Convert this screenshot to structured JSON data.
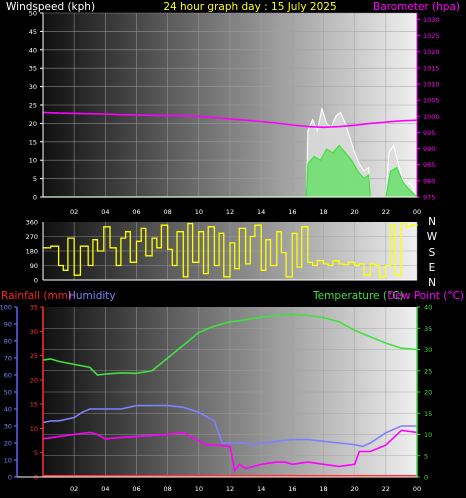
{
  "header": {
    "left": "Windspeed (kph)",
    "center": "24 hour graph day : 15 July 2025",
    "right": "Barometer (hpa)"
  },
  "compass": [
    "N",
    "W",
    "S",
    "E",
    "N"
  ],
  "bottom_header": {
    "rain": "Rainfall (mm)",
    "humidity": "Humidity",
    "temperature": "Temperature (°C)",
    "dewpoint": "Dew Point (°C)"
  },
  "colors": {
    "windspeed_label": "#ffffff",
    "title": "#ffff00",
    "barometer": "#ff00ff",
    "wind_line": "#ffffff",
    "gust_fill": "#70e070",
    "direction": "#ffff00",
    "rain": "#ff3030",
    "humidity": "#8080ff",
    "temperature": "#40e040",
    "dewpoint": "#ff00ff",
    "axis_tick_white": "#ffffff",
    "right_axis_green": "#40e040"
  },
  "chart_data": [
    {
      "id": "wind_baro",
      "type": "line",
      "title": "24 hour graph day : 15 July 2025",
      "x_ticks": [
        "02",
        "04",
        "06",
        "08",
        "10",
        "12",
        "14",
        "16",
        "18",
        "20",
        "22",
        "00"
      ],
      "left_axis": {
        "label": "Windspeed (kph)",
        "ticks": [
          0,
          5,
          10,
          15,
          20,
          25,
          30,
          35,
          40,
          45,
          50
        ],
        "range": [
          0,
          50
        ]
      },
      "right_axis": {
        "label": "Barometer (hpa)",
        "ticks": [
          975,
          980,
          985,
          990,
          995,
          1000,
          1005,
          1010,
          1015,
          1020,
          1025,
          1030
        ],
        "range": [
          975,
          1032
        ]
      },
      "series": [
        {
          "name": "Barometer (hpa)",
          "axis": "right",
          "hours": [
            0,
            1,
            2,
            3,
            4,
            5,
            6,
            7,
            8,
            9,
            10,
            11,
            12,
            13,
            14,
            15,
            16,
            17,
            18,
            19,
            20,
            21,
            22,
            23,
            24
          ],
          "values": [
            1001.2,
            1001.0,
            1000.9,
            1000.8,
            1000.7,
            1000.5,
            1000.4,
            1000.3,
            1000.2,
            1000.2,
            1000.0,
            999.6,
            999.2,
            998.8,
            998.4,
            997.9,
            997.3,
            996.8,
            996.6,
            996.8,
            997.2,
            997.8,
            998.2,
            998.6,
            998.8
          ]
        },
        {
          "name": "Wind gust (kph)",
          "axis": "left",
          "hours": [
            0,
            16.9,
            17.0,
            17.3,
            17.6,
            17.9,
            18.2,
            18.5,
            18.8,
            19.1,
            19.4,
            19.7,
            20.0,
            20.3,
            20.6,
            20.9,
            21.0,
            21.6,
            22.0,
            22.2,
            22.5,
            22.8,
            23.0,
            23.2,
            23.5,
            24
          ],
          "values": [
            0,
            0,
            18,
            21,
            18,
            24,
            20,
            19,
            22,
            23,
            20,
            16,
            12,
            9,
            7,
            8,
            0,
            0,
            0,
            12,
            14,
            9,
            6,
            2,
            4,
            0
          ]
        },
        {
          "name": "Wind speed (kph)",
          "axis": "left",
          "hours": [
            0,
            16.9,
            17.0,
            17.4,
            17.8,
            18.2,
            18.6,
            19.0,
            19.4,
            19.8,
            20.2,
            20.6,
            20.9,
            21.0,
            22.0,
            22.3,
            22.7,
            23.1,
            23.5,
            24
          ],
          "values": [
            0,
            0,
            9,
            11,
            10,
            13,
            12,
            14,
            12,
            10,
            7,
            5,
            6,
            0,
            0,
            7,
            8,
            4,
            2,
            0
          ]
        }
      ]
    },
    {
      "id": "direction",
      "type": "line",
      "x_ticks": [
        "02",
        "04",
        "06",
        "08",
        "10",
        "12",
        "14",
        "16",
        "18",
        "20",
        "22",
        "00"
      ],
      "left_axis": {
        "ticks": [
          0,
          90,
          180,
          270,
          360
        ],
        "range": [
          0,
          360
        ]
      },
      "series": [
        {
          "name": "Wind direction (°)",
          "hours": [
            0,
            0.5,
            1.0,
            1.3,
            1.6,
            2.0,
            2.4,
            2.9,
            3.2,
            3.5,
            3.9,
            4.3,
            4.7,
            5.0,
            5.3,
            5.6,
            6.0,
            6.3,
            6.6,
            7.0,
            7.3,
            7.6,
            8.0,
            8.3,
            8.6,
            9.0,
            9.3,
            9.6,
            10.0,
            10.3,
            10.6,
            11.0,
            11.3,
            11.6,
            12.0,
            12.3,
            12.6,
            13.0,
            13.3,
            13.6,
            14.0,
            14.3,
            14.6,
            15.0,
            15.3,
            15.6,
            16.0,
            16.3,
            16.6,
            17.0,
            17.3,
            17.6,
            18.0,
            18.3,
            18.6,
            19.0,
            19.3,
            19.6,
            20.0,
            20.3,
            20.6,
            21.0,
            21.3,
            21.6,
            22.0,
            22.3,
            22.6,
            23.0,
            23.3,
            23.6,
            24.0
          ],
          "values": [
            200,
            210,
            90,
            60,
            260,
            30,
            210,
            90,
            250,
            180,
            330,
            200,
            90,
            260,
            300,
            110,
            240,
            320,
            150,
            260,
            200,
            340,
            190,
            90,
            300,
            20,
            350,
            110,
            300,
            40,
            330,
            90,
            290,
            20,
            230,
            70,
            320,
            100,
            270,
            340,
            60,
            250,
            90,
            300,
            170,
            20,
            290,
            80,
            330,
            110,
            90,
            120,
            100,
            90,
            120,
            100,
            95,
            110,
            90,
            100,
            30,
            100,
            90,
            20,
            90,
            340,
            30,
            350,
            330,
            340,
            345
          ]
        }
      ]
    },
    {
      "id": "rain_temp",
      "type": "line",
      "x_ticks": [
        "02",
        "04",
        "06",
        "08",
        "10",
        "12",
        "14",
        "16",
        "18",
        "20",
        "22",
        "00"
      ],
      "humidity_axis": {
        "label": "Humidity",
        "ticks": [
          0,
          10,
          20,
          30,
          40,
          50,
          60,
          70,
          80,
          90,
          100
        ],
        "range": [
          0,
          100
        ]
      },
      "rain_axis": {
        "label": "Rainfall (mm)",
        "ticks": [
          0,
          5,
          10,
          15,
          20,
          25,
          30,
          35
        ],
        "range": [
          0,
          35
        ]
      },
      "temp_axis": {
        "label": "Temperature (°C)",
        "ticks": [
          0,
          5,
          10,
          15,
          20,
          25,
          30,
          35,
          40
        ],
        "range": [
          0,
          40
        ]
      },
      "series": [
        {
          "name": "Temperature (°C)",
          "axis": "temp",
          "hours": [
            0,
            0.5,
            1,
            2,
            3,
            3.5,
            4,
            5,
            6,
            7,
            8,
            9,
            10,
            11,
            12,
            13,
            14,
            15,
            16,
            17,
            18,
            19,
            20,
            21,
            22,
            23,
            24
          ],
          "values": [
            27.5,
            27.8,
            27.2,
            26.5,
            25.8,
            24.0,
            24.2,
            24.5,
            24.4,
            25.0,
            28.0,
            31.0,
            34.0,
            35.5,
            36.5,
            37.0,
            37.6,
            38.0,
            38.3,
            38.0,
            37.5,
            36.5,
            34.5,
            33.0,
            31.5,
            30.3,
            30.0
          ]
        },
        {
          "name": "Humidity",
          "axis": "humidity",
          "hours": [
            0,
            0.5,
            1,
            2,
            2.5,
            3,
            4,
            5,
            6,
            7,
            8,
            9,
            10,
            11,
            11.5,
            12,
            13,
            13.5,
            14,
            15,
            16,
            17,
            18,
            19,
            20,
            20.5,
            21,
            22,
            23,
            24
          ],
          "values": [
            32,
            33,
            33,
            35,
            38,
            40,
            40,
            40,
            42,
            42,
            42,
            41,
            38,
            33,
            20,
            20,
            20,
            19,
            20,
            21,
            22,
            22,
            21,
            20,
            19,
            18,
            20,
            26,
            30,
            30
          ]
        },
        {
          "name": "Dew Point (°C)",
          "axis": "temp",
          "hours": [
            0,
            1,
            2,
            3,
            3.5,
            4,
            5,
            6,
            7,
            8,
            9,
            10,
            10.5,
            11,
            12,
            12.3,
            12.6,
            13,
            14,
            15,
            15.5,
            16,
            17,
            18,
            19,
            20,
            20.3,
            21,
            22,
            23,
            24
          ],
          "values": [
            9,
            9.5,
            10,
            10.5,
            10,
            9,
            9.3,
            9.5,
            9.8,
            10,
            10.5,
            8.5,
            7.5,
            7.5,
            7.2,
            1.5,
            3.0,
            2.0,
            3.0,
            3.5,
            3.5,
            3.0,
            3.5,
            3.0,
            2.5,
            3.0,
            6.0,
            6.0,
            7.5,
            11,
            10.5
          ]
        },
        {
          "name": "Rainfall (mm)",
          "axis": "rain",
          "hours": [
            0,
            24
          ],
          "values": [
            0.2,
            0.2
          ]
        }
      ]
    }
  ]
}
